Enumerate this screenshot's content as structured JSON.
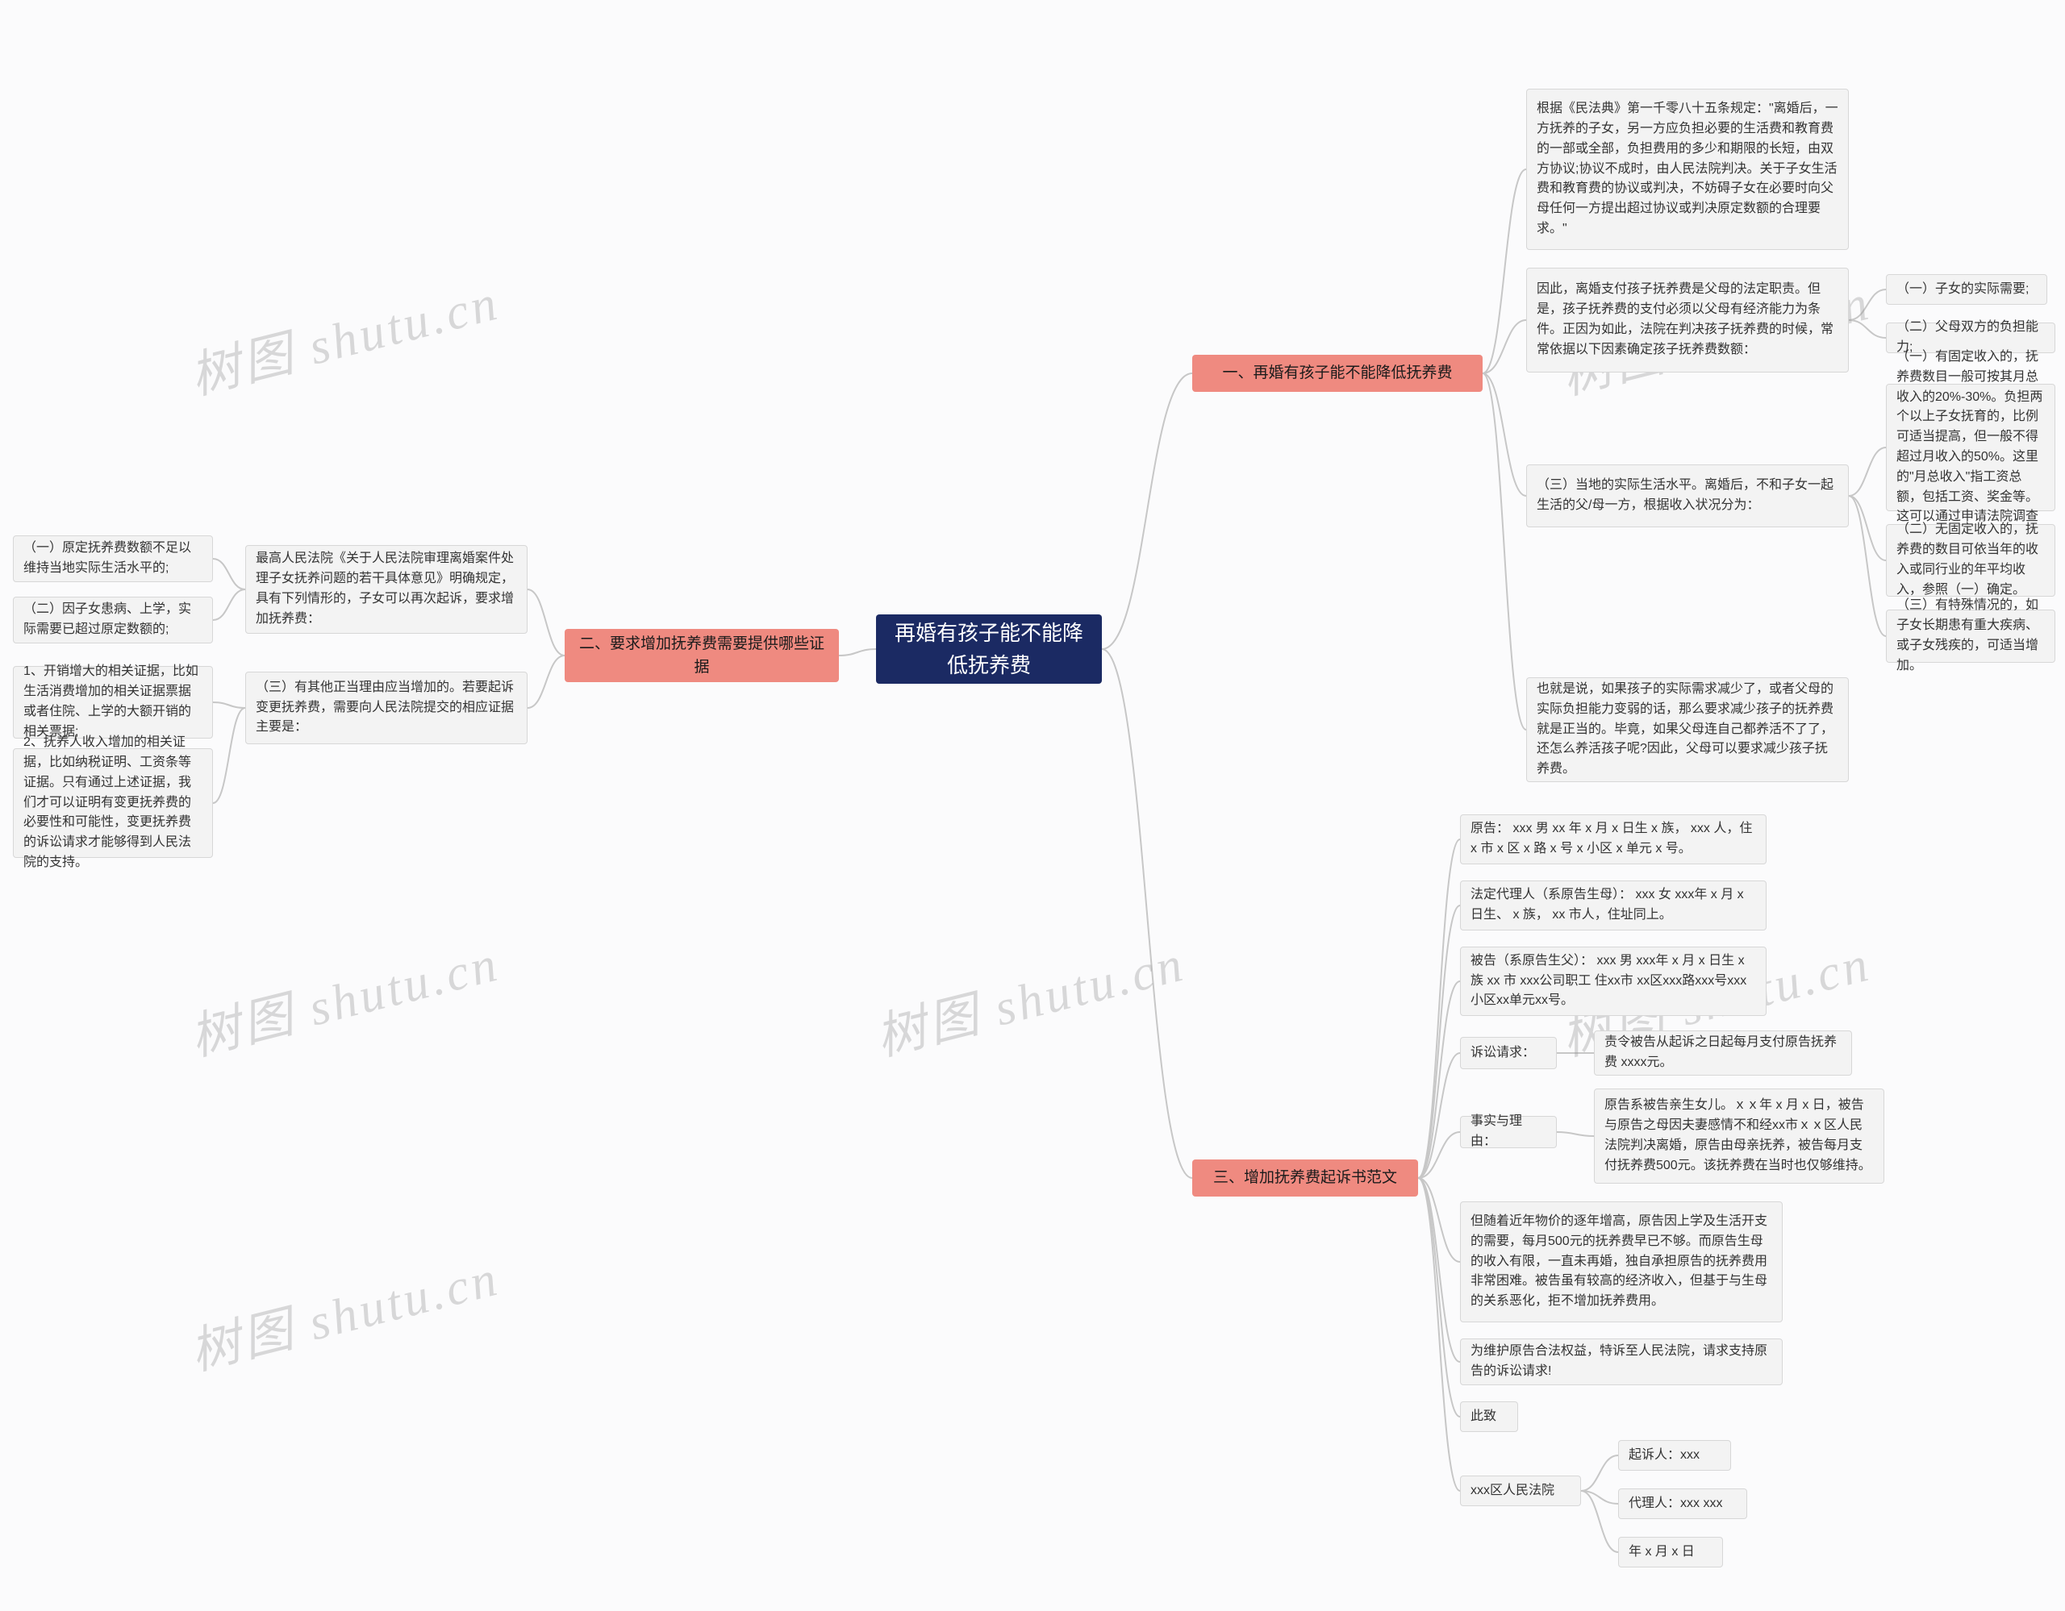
{
  "watermark": "树图 shutu.cn",
  "root": {
    "id": "root",
    "text": "再婚有孩子能不能降低抚养费"
  },
  "branches": {
    "b1": {
      "text": "一、再婚有孩子能不能降低抚养费"
    },
    "b2": {
      "text": "二、要求增加抚养费需要提供哪些证据"
    },
    "b3": {
      "text": "三、增加抚养费起诉书范文"
    }
  },
  "b1_children": {
    "c1": {
      "text": "根据《民法典》第一千零八十五条规定：\"离婚后，一方抚养的子女，另一方应负担必要的生活费和教育费的一部或全部，负担费用的多少和期限的长短，由双方协议;协议不成时，由人民法院判决。关于子女生活费和教育费的协议或判决，不妨碍子女在必要时向父母任何一方提出超过协议或判决原定数额的合理要求。\""
    },
    "c2": {
      "text": "因此，离婚支付孩子抚养费是父母的法定职责。但是，孩子抚养费的支付必须以父母有经济能力为条件。正因为如此，法院在判决孩子抚养费的时候，常常依据以下因素确定孩子抚养费数额："
    },
    "c2a": {
      "text": "（一）子女的实际需要;"
    },
    "c2b": {
      "text": "（二）父母双方的负担能力;"
    },
    "c3": {
      "text": "（三）当地的实际生活水平。离婚后，不和子女一起生活的父/母一方，根据收入状况分为："
    },
    "c3a": {
      "text": "（一）有固定收入的，抚养费数目一般可按其月总收入的20%-30%。负担两个以上子女抚育的，比例可适当提高，但一般不得超过月收入的50%。这里的\"月总收入\"指工资总额，包括工资、奖金等。这可以通过申请法院调查令来调查;"
    },
    "c3b": {
      "text": "（二）无固定收入的，抚养费的数目可依当年的收入或同行业的年平均收入，参照（一）确定。"
    },
    "c3c": {
      "text": "（三）有特殊情况的，如子女长期患有重大疾病、或子女残疾的，可适当增加。"
    },
    "c4": {
      "text": "也就是说，如果孩子的实际需求减少了，或者父母的实际负担能力变弱的话，那么要求减少孩子的抚养费就是正当的。毕竟，如果父母连自己都养活不了了，还怎么养活孩子呢?因此，父母可以要求减少孩子抚养费。"
    }
  },
  "b2_children": {
    "d1": {
      "text": "最高人民法院《关于人民法院审理离婚案件处理子女抚养问题的若干具体意见》明确规定，具有下列情形的，子女可以再次起诉，要求增加抚养费："
    },
    "d1a": {
      "text": "（一）原定抚养费数额不足以维持当地实际生活水平的;"
    },
    "d1b": {
      "text": "（二）因子女患病、上学，实际需要已超过原定数额的;"
    },
    "d2": {
      "text": "（三）有其他正当理由应当增加的。若要起诉变更抚养费，需要向人民法院提交的相应证据主要是："
    },
    "d2a": {
      "text": "1、开销增大的相关证据，比如生活消费增加的相关证据票据或者住院、上学的大额开销的相关票据;"
    },
    "d2b": {
      "text": "2、抚养人收入增加的相关证据，比如纳税证明、工资条等证据。只有通过上述证据，我们才可以证明有变更抚养费的必要性和可能性，变更抚养费的诉讼请求才能够得到人民法院的支持。"
    }
  },
  "b3_children": {
    "e1": {
      "text": "原告： xxx 男 xx 年 x 月 x 日生 x 族， xxx 人，住 x 市 x 区 x 路 x 号 x 小区 x 单元 x 号。"
    },
    "e2": {
      "text": "法定代理人（系原告生母）： xxx 女 xxx年 x 月 x 日生、 x 族， xx 市人，住址同上。"
    },
    "e3": {
      "text": "被告（系原告生父）： xxx 男 xxx年 x 月 x 日生 x 族 xx 市 xxx公司职工 住xx市 xx区xxx路xxx号xxx小区xx单元xx号。"
    },
    "e4": {
      "text": "诉讼请求："
    },
    "e4a": {
      "text": "责令被告从起诉之日起每月支付原告抚养费 xxxx元。"
    },
    "e5": {
      "text": "事实与理由："
    },
    "e5a": {
      "text": "原告系被告亲生女儿。ｘｘ年 x 月 x 日，被告与原告之母因夫妻感情不和经xx市ｘｘ区人民法院判决离婚，原告由母亲抚养，被告每月支付抚养费500元。该抚养费在当时也仅够维持。"
    },
    "e6": {
      "text": "但随着近年物价的逐年增高，原告因上学及生活开支的需要，每月500元的抚养费早已不够。而原告生母的收入有限，一直未再婚，独自承担原告的抚养费用非常困难。被告虽有较高的经济收入，但基于与生母的关系恶化，拒不增加抚养费用。"
    },
    "e7": {
      "text": "为维护原告合法权益，特诉至人民法院，请求支持原告的诉讼请求!"
    },
    "e8": {
      "text": "此致"
    },
    "e9": {
      "text": "xxx区人民法院"
    },
    "e9a": {
      "text": "起诉人：xxx"
    },
    "e9b": {
      "text": "代理人：xxx xxx"
    },
    "e9c": {
      "text": "年 x 月 x 日"
    }
  },
  "colors": {
    "root_bg": "#1b2a63",
    "branch_bg": "#ef8a80",
    "leaf_bg": "#f3f3f3",
    "connector": "#c7c7c7"
  }
}
